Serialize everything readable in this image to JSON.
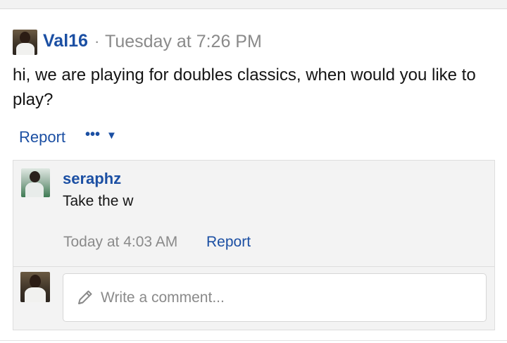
{
  "post": {
    "author": "Val16",
    "separator": "·",
    "time": "Tuesday at 7:26 PM",
    "body": "hi, we are playing for doubles classics, when would you like to play?",
    "report_label": "Report",
    "more_dots": "•••",
    "more_caret": "▼"
  },
  "comment": {
    "author": "seraphz",
    "body": "Take the w",
    "time": "Today at 4:03 AM",
    "report_label": "Report"
  },
  "composer": {
    "placeholder": "Write a comment..."
  },
  "colors": {
    "link": "#1b4fa3",
    "muted": "#8a8a8a",
    "panel": "#f3f3f3"
  },
  "icons": [
    "avatar",
    "more-options-icon",
    "chevron-down-icon",
    "pencil-icon"
  ]
}
